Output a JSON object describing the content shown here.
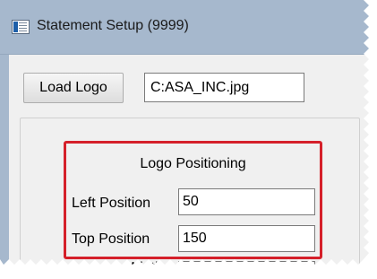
{
  "window": {
    "title": "Statement Setup (9999)",
    "icon": "window-app-icon"
  },
  "toolbar": {
    "load_logo_label": "Load Logo",
    "logo_path": "C:ASA_INC.jpg"
  },
  "logo_positioning": {
    "title": "Logo Positioning",
    "left_label": "Left Position",
    "left_value": "50",
    "top_label": "Top Position",
    "top_value": "150",
    "width_label": "Width"
  },
  "colors": {
    "titlebar": "#a6b8cd",
    "highlight": "#d5202a",
    "panel": "#f0f0f0"
  }
}
